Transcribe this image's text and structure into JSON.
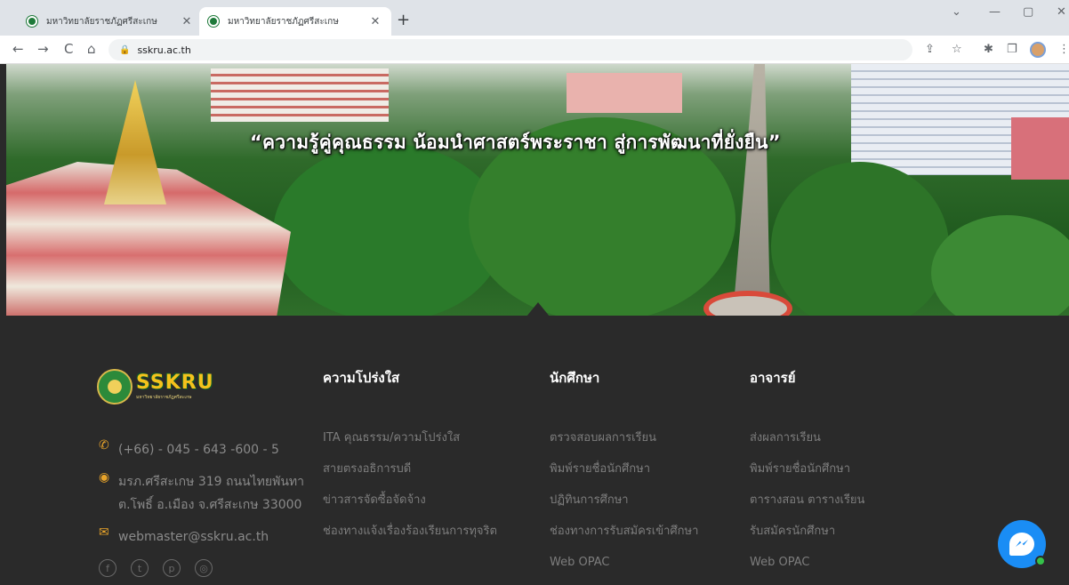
{
  "browser": {
    "tabs": [
      {
        "title": "มหาวิทยาลัยราชภัฏศรีสะเกษ",
        "active": false
      },
      {
        "title": "มหาวิทยาลัยราชภัฏศรีสะเกษ",
        "active": true
      }
    ],
    "new_tab": "+",
    "url": "sskru.ac.th",
    "icons": {
      "back": "←",
      "forward": "→",
      "reload": "C",
      "home": "⌂",
      "lock": "🔒",
      "share": "⇪",
      "star": "☆",
      "extensions": "✱",
      "sidebar": "❐",
      "menu": "⋮",
      "minimize": "—",
      "maximize": "▢",
      "close": "✕",
      "tab_list": "⌄",
      "tab_close": "✕"
    }
  },
  "hero": {
    "slogan": "“ความรู้คู่คุณธรรม น้อมนำศาสตร์พระราชา สู่การพัฒนาที่ยั่งยืน”"
  },
  "footer": {
    "logo": {
      "brand": "SSKRU",
      "sub": "มหาวิทยาลัยราชภัฏศรีสะเกษ"
    },
    "contact": {
      "phone": "(+66) - 045 - 643 -600 - 5",
      "address_line1": "มรภ.ศรีสะเกษ 319 ถนนไทยพันทา",
      "address_line2": "ต.โพธิ์ อ.เมือง จ.ศรีสะเกษ 33000",
      "email": "webmaster@sskru.ac.th"
    },
    "social_icons": [
      "facebook-icon",
      "twitter-icon",
      "pinterest-icon",
      "instagram-icon"
    ],
    "columns": [
      {
        "heading": "ความโปร่งใส",
        "links": [
          "ITA คุณธรรม/ความโปร่งใส",
          "สายตรงอธิการบดี",
          "ข่าวสารจัดซื้อจัดจ้าง",
          "ช่องทางแจ้งเรื่องร้องเรียนการทุจริต"
        ]
      },
      {
        "heading": "นักศึกษา",
        "links": [
          "ตรวจสอบผลการเรียน",
          "พิมพ์รายชื่อนักศึกษา",
          "ปฏิทินการศึกษา",
          "ช่องทางการรับสมัครเข้าศึกษา",
          "Web OPAC"
        ]
      },
      {
        "heading": "อาจารย์",
        "links": [
          "ส่งผลการเรียน",
          "พิมพ์รายชื่อนักศึกษา",
          "ตารางสอน ตารางเรียน",
          "รับสมัครนักศึกษา",
          "Web OPAC"
        ]
      }
    ]
  },
  "colors": {
    "accent_icon": "#e8a42a",
    "footer_bg": "#2a2a2a",
    "messenger": "#1a8df5"
  }
}
